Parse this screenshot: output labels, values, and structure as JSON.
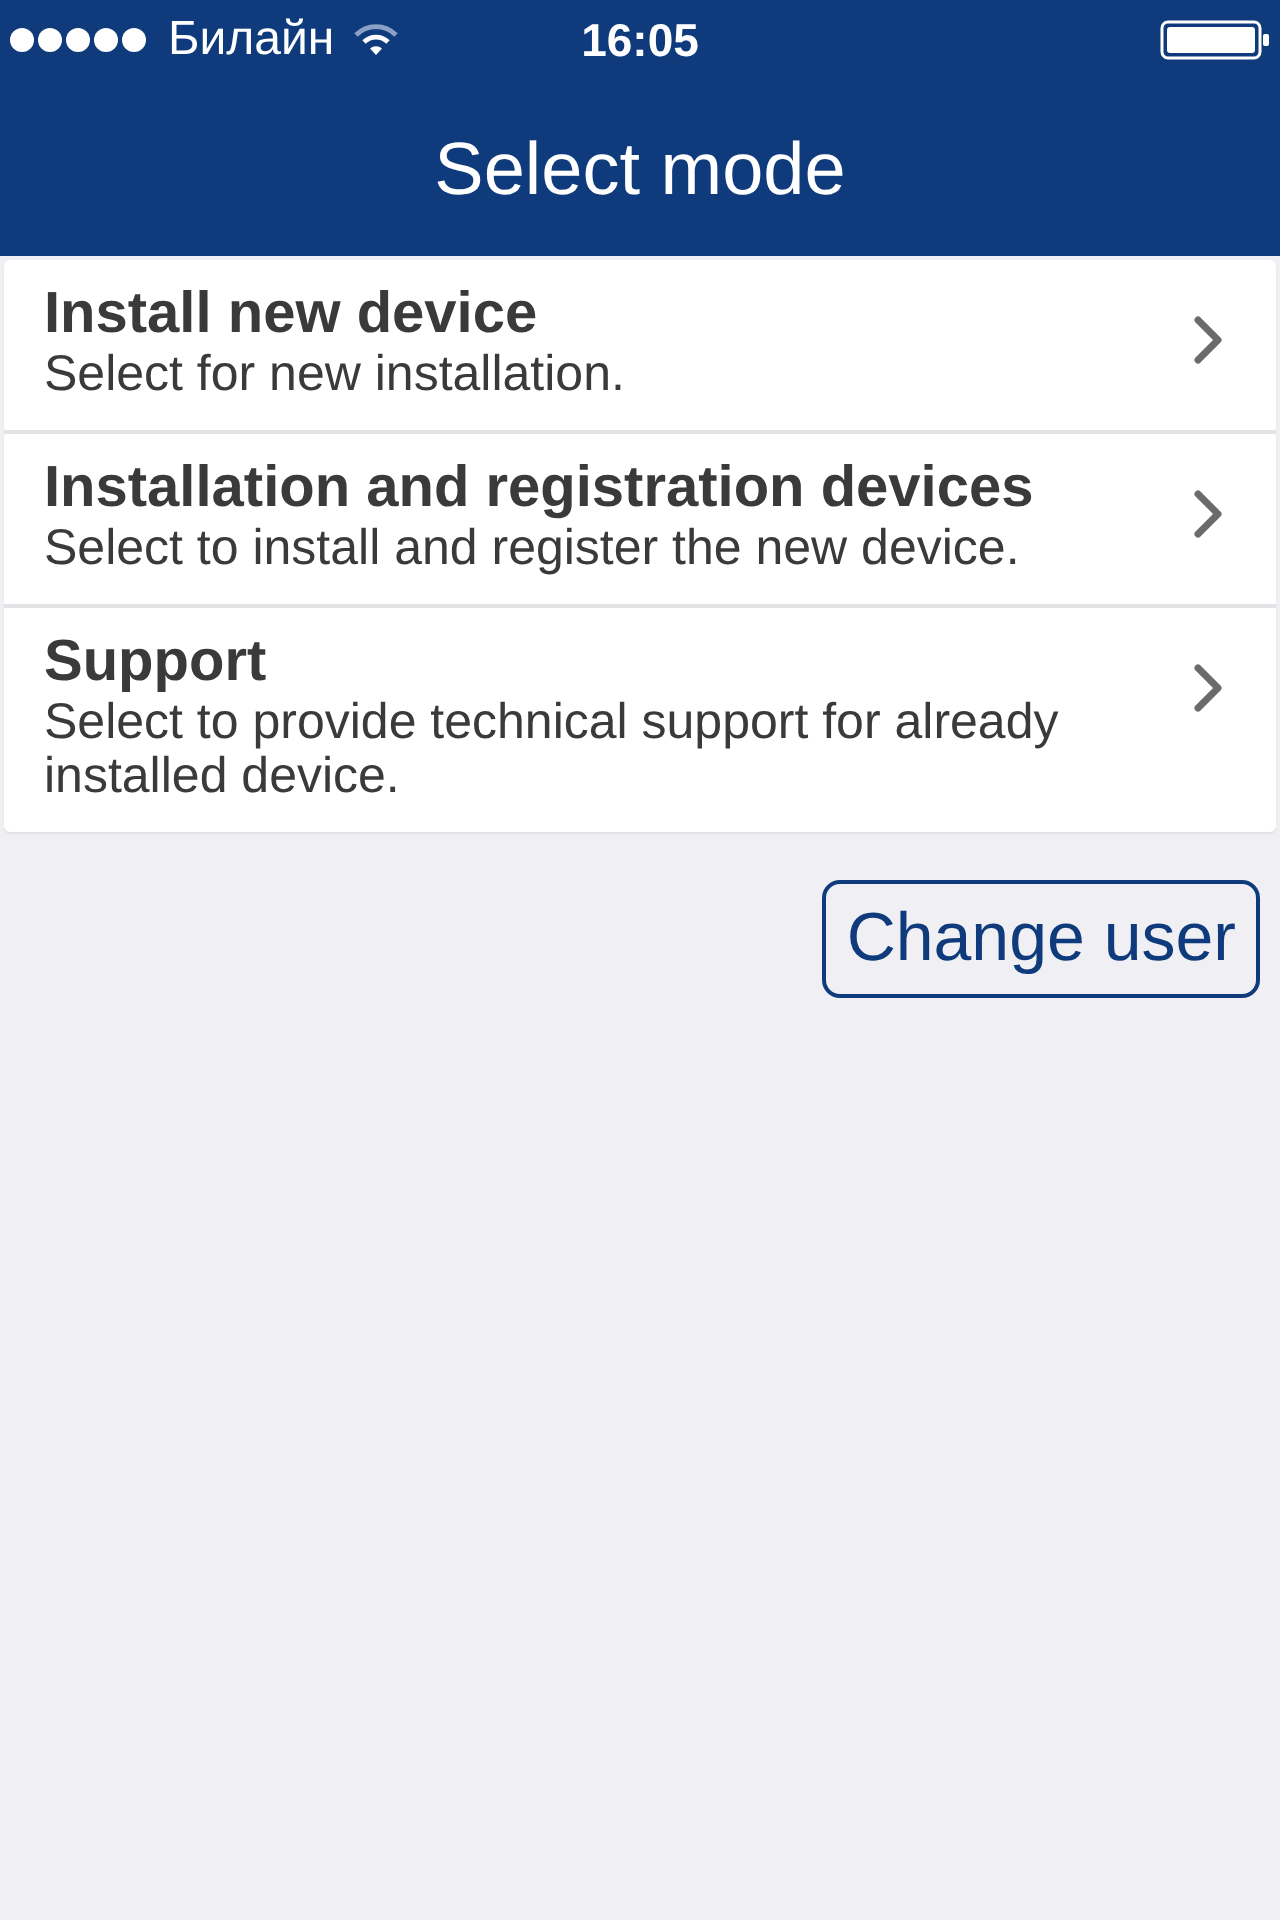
{
  "status_bar": {
    "carrier": "Билайн",
    "time": "16:05"
  },
  "header": {
    "title": "Select mode"
  },
  "modes": [
    {
      "title": "Install new device",
      "description": "Select for new installation."
    },
    {
      "title": "Installation and registration devices",
      "description": "Select to install and register the new device."
    },
    {
      "title": "Support",
      "description": "Select to provide technical support for already installed device."
    }
  ],
  "change_user_button": {
    "label": "Change user"
  }
}
